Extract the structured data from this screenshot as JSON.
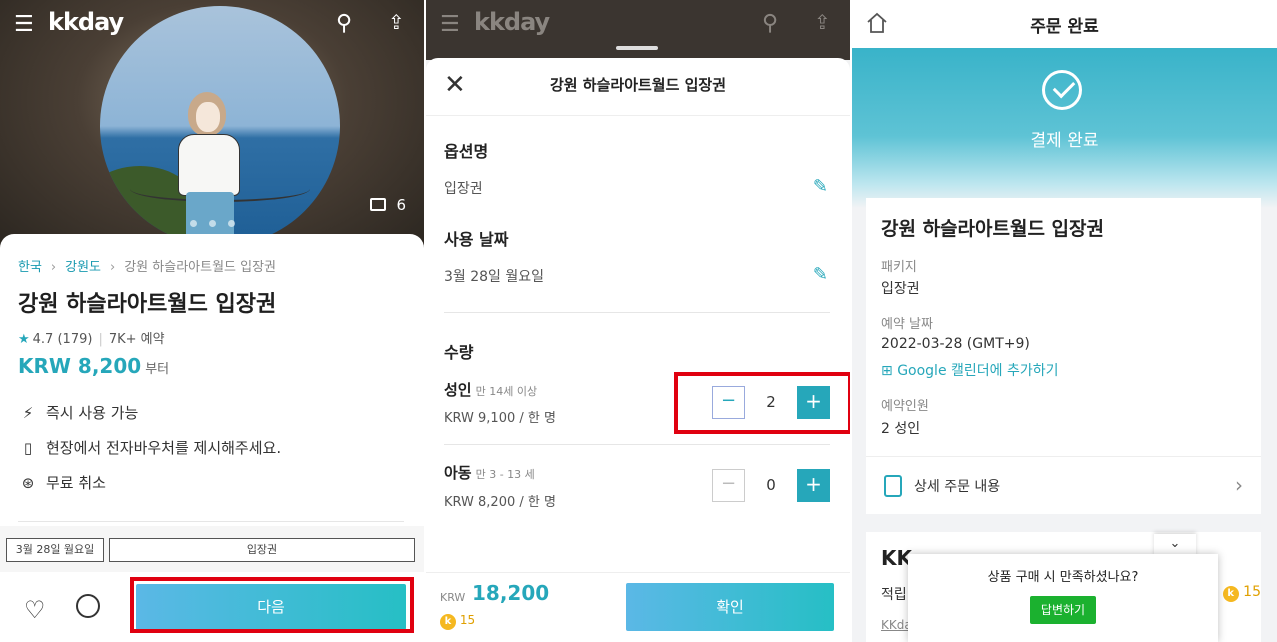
{
  "panel1": {
    "logo": "kkday",
    "photo_count": "6",
    "breadcrumb": {
      "country": "한국",
      "region": "강원도",
      "current": "강원 하슬라아트월드 입장권"
    },
    "title": "강원 하슬라아트월드 입장권",
    "rating": "4.7",
    "review_count": "(179)",
    "bookings": "7K+ 예약",
    "price": "KRW 8,200",
    "price_suffix": "부터",
    "features": [
      "즉시 사용 가능",
      "현장에서 전자바우처를 제시해주세요.",
      "무료 취소"
    ],
    "chip_date": "3월 28일 월요일",
    "chip_option": "입장권",
    "next_button": "다음"
  },
  "panel2": {
    "logo": "kkday",
    "sheet_title": "강원 하슬라아트월드 입장권",
    "option_label": "옵션명",
    "option_value": "입장권",
    "date_label": "사용 날짜",
    "date_value": "3월 28일 월요일",
    "qty_label": "수량",
    "adult": {
      "label": "성인",
      "sub": "만 14세 이상",
      "price": "KRW 9,100 / 한 명",
      "qty": "2"
    },
    "child": {
      "label": "아동",
      "sub": "만 3 - 13 세",
      "price": "KRW 8,200 / 한 명",
      "qty": "0"
    },
    "total_currency": "KRW",
    "total_value": "18,200",
    "points": "15",
    "confirm_button": "확인"
  },
  "panel3": {
    "header_title": "주문 완료",
    "status": "결제 완료",
    "product": "강원 하슬라아트월드 입장권",
    "package_label": "패키지",
    "package_value": "입장권",
    "date_label": "예약 날짜",
    "date_value": "2022-03-28 (GMT+9)",
    "calendar_link": "Google 캘린더에 추가하기",
    "people_label": "예약인원",
    "people_value": "2 성인",
    "detail_link": "상세 주문 내용",
    "card2_title": "KK",
    "card2_points_label": "적립",
    "card2_link": "KKda",
    "card2_points": "15",
    "popup_question": "상품 구매 시 만족하셨나요?",
    "popup_button": "답변하기"
  }
}
